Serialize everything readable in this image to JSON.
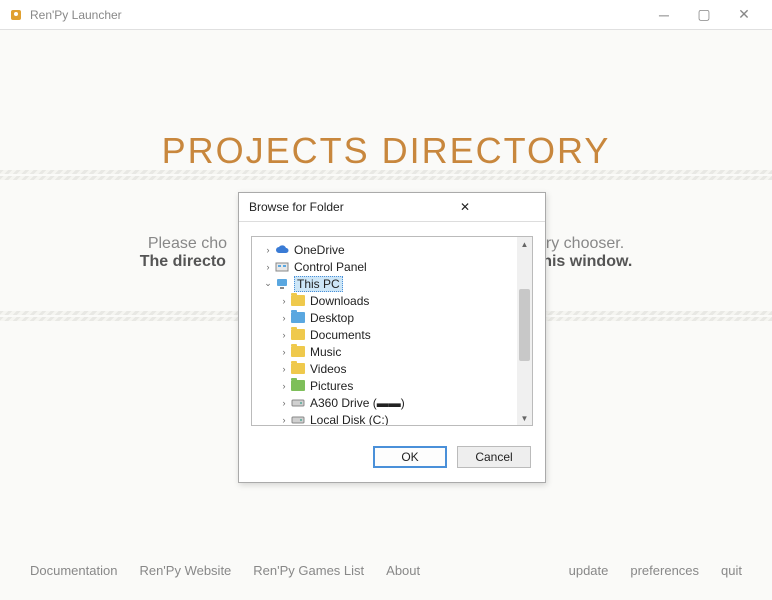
{
  "window": {
    "title": "Ren'Py Launcher"
  },
  "main": {
    "heading": "PROJECTS DIRECTORY",
    "line1a": "Please cho",
    "line1b": "ry chooser.",
    "line2a": "The directo",
    "line2b": "this window."
  },
  "footer": {
    "left": [
      "Documentation",
      "Ren'Py Website",
      "Ren'Py Games List",
      "About"
    ],
    "right": [
      "update",
      "preferences",
      "quit"
    ]
  },
  "dialog": {
    "title": "Browse for Folder",
    "ok": "OK",
    "cancel": "Cancel",
    "tree": [
      {
        "ind": 1,
        "exp": ">",
        "icon": "cloud",
        "label": "OneDrive",
        "selected": false
      },
      {
        "ind": 1,
        "exp": ">",
        "icon": "panel",
        "label": "Control Panel",
        "selected": false
      },
      {
        "ind": 1,
        "exp": "v",
        "icon": "pc",
        "label": "This PC",
        "selected": true
      },
      {
        "ind": 2,
        "exp": ">",
        "icon": "folder-yellow",
        "label": "Downloads",
        "selected": false
      },
      {
        "ind": 2,
        "exp": ">",
        "icon": "folder-blue",
        "label": "Desktop",
        "selected": false
      },
      {
        "ind": 2,
        "exp": ">",
        "icon": "folder-yellow",
        "label": "Documents",
        "selected": false
      },
      {
        "ind": 2,
        "exp": ">",
        "icon": "folder-yellow",
        "label": "Music",
        "selected": false
      },
      {
        "ind": 2,
        "exp": ">",
        "icon": "folder-yellow",
        "label": "Videos",
        "selected": false
      },
      {
        "ind": 2,
        "exp": ">",
        "icon": "folder-green",
        "label": "Pictures",
        "selected": false
      },
      {
        "ind": 2,
        "exp": ">",
        "icon": "disk",
        "label": "A360 Drive (▬▬)",
        "selected": false
      },
      {
        "ind": 2,
        "exp": ">",
        "icon": "disk",
        "label": "Local Disk (C:)",
        "selected": false
      }
    ]
  }
}
